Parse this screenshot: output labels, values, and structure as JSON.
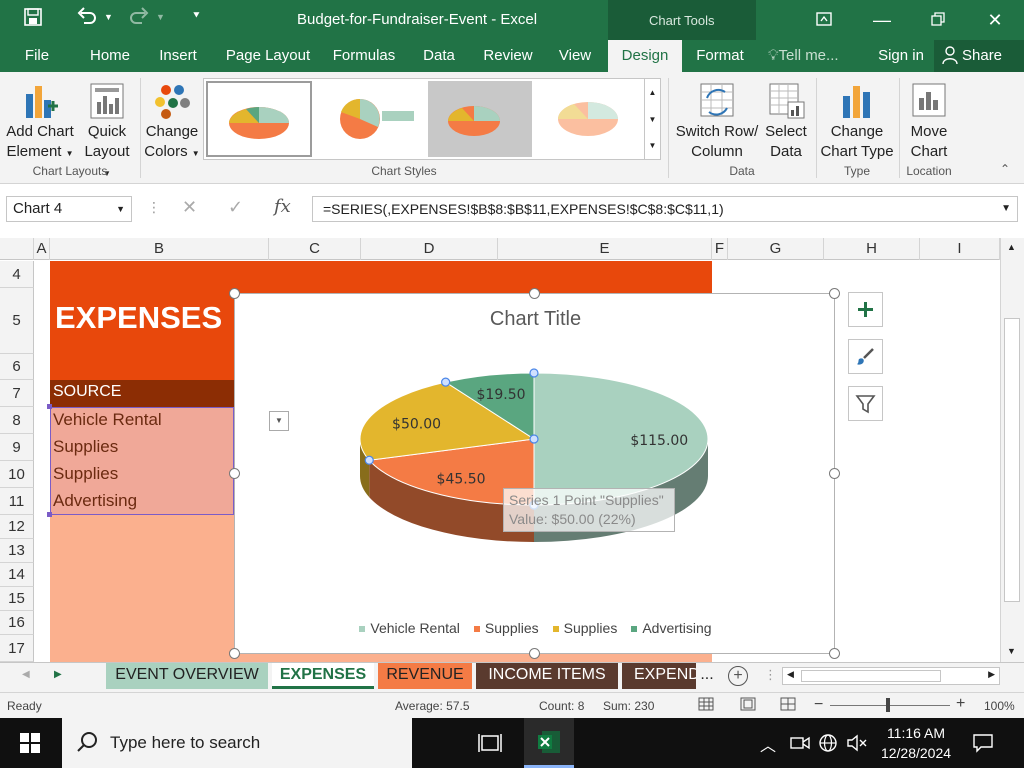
{
  "window": {
    "title": "Budget-for-Fundraiser-Event  -  Excel",
    "context_label": "Chart Tools"
  },
  "tabs": [
    "File",
    "Home",
    "Insert",
    "Page Layout",
    "Formulas",
    "Data",
    "Review",
    "View",
    "Design",
    "Format"
  ],
  "active_tab": "Design",
  "tell_me": "Tell me...",
  "sign_in": "Sign in",
  "share": "Share",
  "ribbon": {
    "add_chart_element": [
      "Add Chart",
      "Element"
    ],
    "quick_layout": [
      "Quick",
      "Layout"
    ],
    "change_colors": [
      "Change",
      "Colors"
    ],
    "chart_layouts_label": "Chart Layouts",
    "chart_styles_label": "Chart Styles",
    "switch_row_column": [
      "Switch Row/",
      "Column"
    ],
    "select_data": [
      "Select",
      "Data"
    ],
    "data_label": "Data",
    "change_chart_type": [
      "Change",
      "Chart Type"
    ],
    "type_label": "Type",
    "move_chart": [
      "Move",
      "Chart"
    ],
    "location_label": "Location"
  },
  "formula_bar": {
    "name_box": "Chart 4",
    "formula": "=SERIES(,EXPENSES!$B$8:$B$11,EXPENSES!$C$8:$C$11,1)",
    "fx": "fx"
  },
  "grid": {
    "columns": [
      "A",
      "B",
      "C",
      "D",
      "E",
      "F",
      "G",
      "H",
      "I"
    ],
    "rows": [
      "4",
      "5",
      "6",
      "7",
      "8",
      "9",
      "10",
      "11",
      "12",
      "13",
      "14",
      "15",
      "16",
      "17"
    ],
    "heading": "EXPENSES",
    "source_header": "SOURCE",
    "sources": [
      "Vehicle Rental",
      "Supplies",
      "Supplies",
      "Advertising"
    ]
  },
  "chart_data": {
    "type": "pie",
    "title": "Chart Title",
    "categories": [
      "Vehicle Rental",
      "Supplies",
      "Supplies",
      "Advertising"
    ],
    "values": [
      115.0,
      45.5,
      50.0,
      19.5
    ],
    "data_labels": [
      "$115.00",
      "$45.50",
      "$50.00",
      "$19.50"
    ],
    "colors": [
      "#a9d1bf",
      "#f47b45",
      "#e3b62d",
      "#5aa680"
    ],
    "legend_position": "bottom",
    "tooltip": [
      "Series 1 Point \"Supplies\"",
      "Value: $50.00 (22%)"
    ]
  },
  "sheet_tabs": [
    {
      "label": "EVENT OVERVIEW",
      "color": "#a9d1bf",
      "text": "#222"
    },
    {
      "label": "EXPENSES",
      "color": "#ffffff",
      "text": "#217346"
    },
    {
      "label": "REVENUE",
      "color": "#f47b45",
      "text": "#222"
    },
    {
      "label": "INCOME ITEMS",
      "color": "#5a3a2e",
      "text": "#ffffff"
    },
    {
      "label": "EXPEND",
      "color": "#5a3a2e",
      "text": "#ffffff"
    }
  ],
  "sheet_more": "...",
  "status": {
    "ready": "Ready",
    "average": "Average: 57.5",
    "count": "Count: 8",
    "sum": "Sum: 230",
    "zoom": "100%"
  },
  "taskbar": {
    "search_placeholder": "Type here to search",
    "time": "11:16 AM",
    "date": "12/28/2024"
  },
  "colors": {
    "excel_green": "#217346",
    "expenses_orange": "#e8480c",
    "source_brown": "#8c2d04",
    "list_pink": "#f0a898",
    "light_peach": "#fbb08e"
  }
}
